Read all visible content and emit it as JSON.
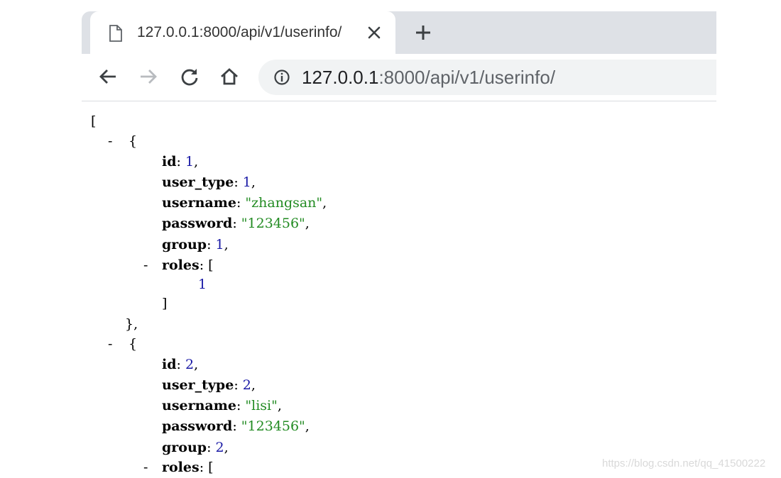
{
  "browser": {
    "tab": {
      "title": "127.0.0.1:8000/api/v1/userinfo/",
      "icon": "page-icon",
      "close_icon": "close-icon"
    },
    "new_tab_icon": "plus-icon",
    "toolbar": {
      "back_icon": "back-arrow-icon",
      "forward_icon": "forward-arrow-icon",
      "reload_icon": "reload-icon",
      "home_icon": "home-icon",
      "info_icon": "info-icon"
    },
    "address_bar": {
      "host": "127.0.0.1",
      "rest": ":8000/api/v1/userinfo/"
    }
  },
  "json_view": {
    "open_bracket": "[",
    "collapse_toggle": "-",
    "records": [
      {
        "id": "1",
        "user_type": "1",
        "username": "\"zhangsan\"",
        "password": "\"123456\"",
        "group": "1",
        "roles": [
          "1"
        ]
      },
      {
        "id": "2",
        "user_type": "2",
        "username": "\"lisi\"",
        "password": "\"123456\"",
        "group": "2",
        "roles": []
      }
    ],
    "labels": {
      "id": "id",
      "user_type": "user_type",
      "username": "username",
      "password": "password",
      "group": "group",
      "roles": "roles"
    }
  },
  "watermark": "https://blog.csdn.net/qq_41500222",
  "colors": {
    "tabstrip": "#dee1e6",
    "omnibox": "#f1f3f4",
    "json_number": "#1a1aa6",
    "json_string": "#228b22"
  }
}
